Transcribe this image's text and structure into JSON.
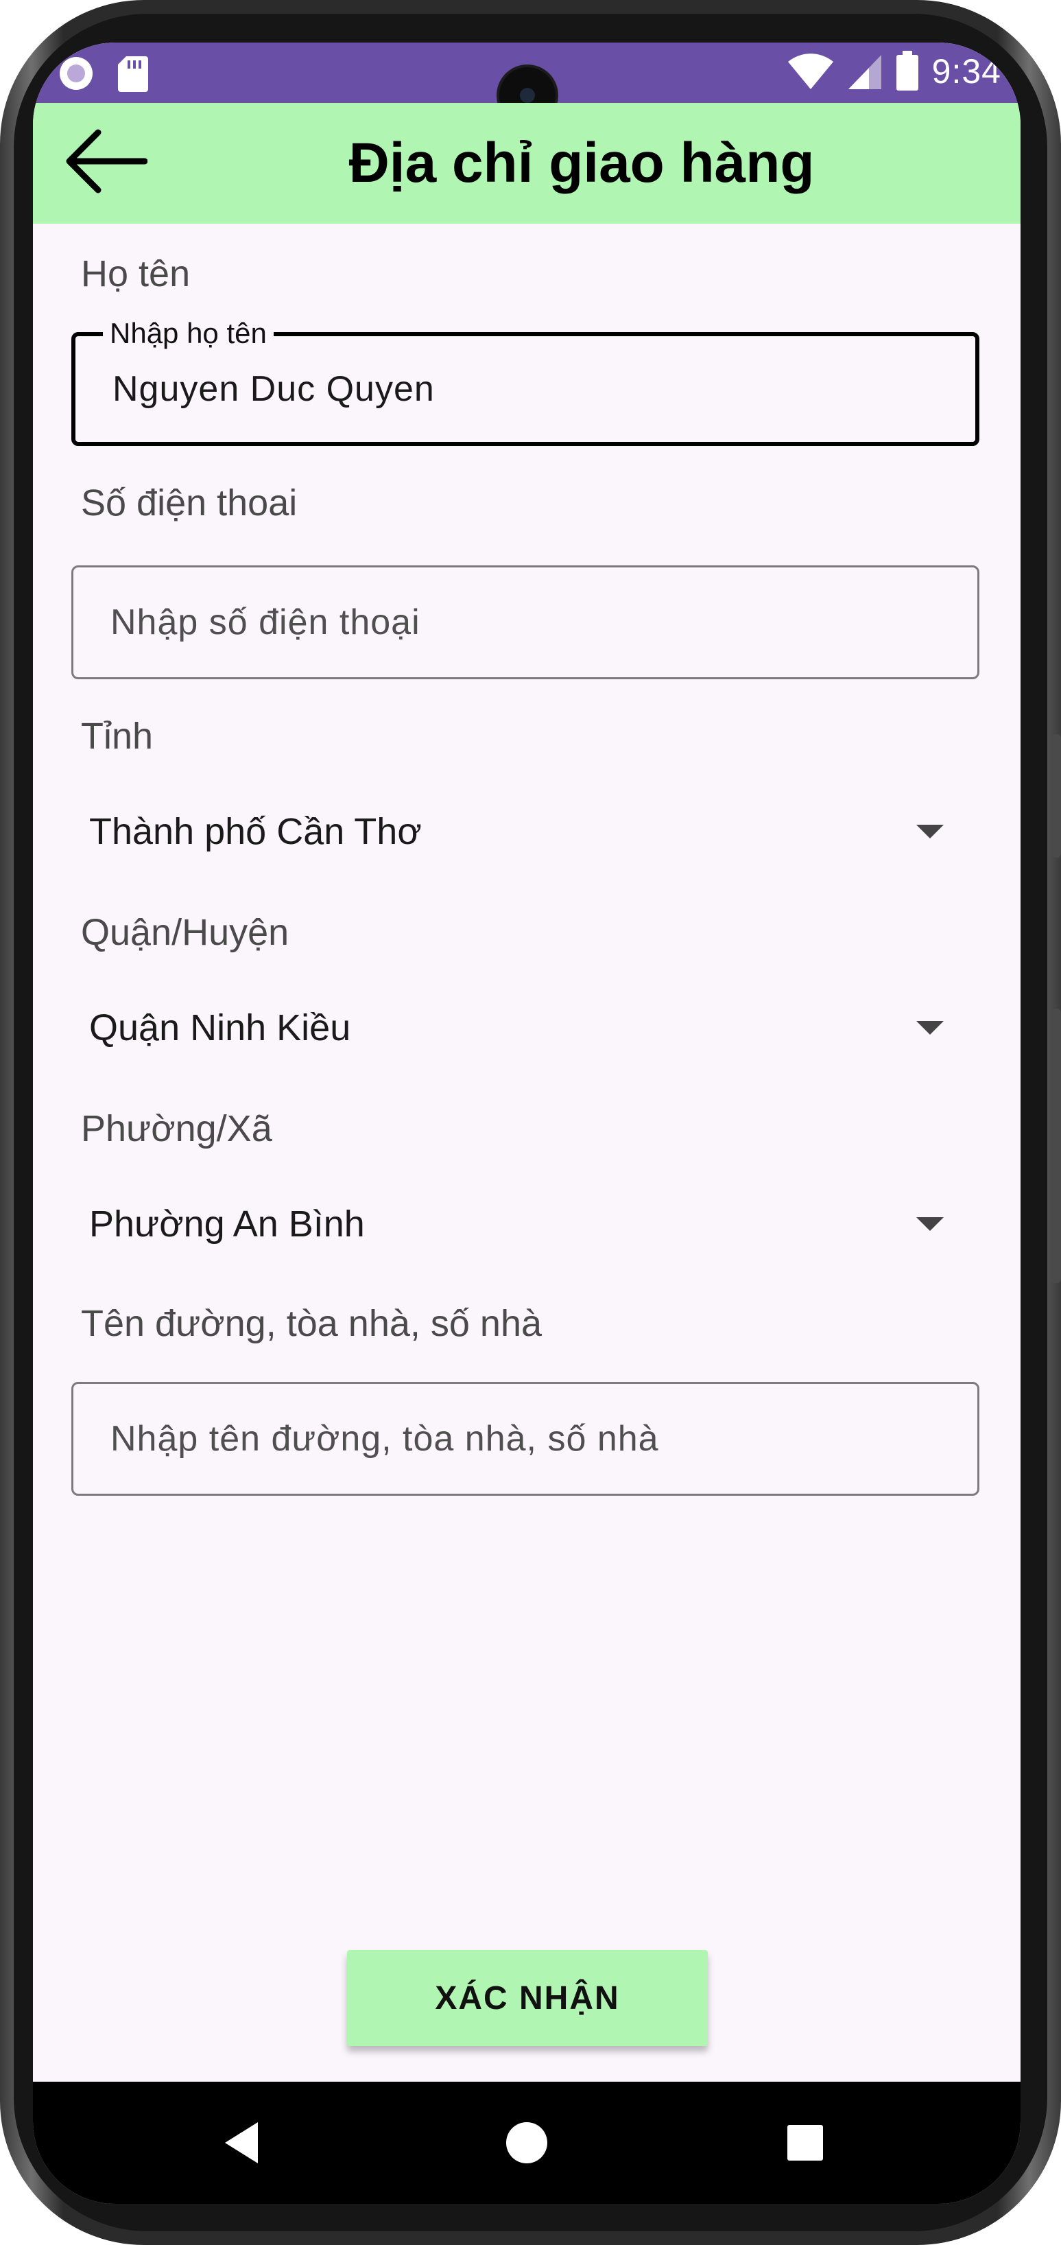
{
  "status_bar": {
    "time": "9:34",
    "left_icons": [
      "record-icon",
      "sd-card-icon"
    ],
    "right_icons": [
      "wifi-icon",
      "signal-icon",
      "battery-icon"
    ],
    "color": "#6950a6"
  },
  "app_bar": {
    "title": "Địa chỉ giao hàng",
    "back_icon": "arrow-back-icon",
    "color": "#b0f5b2"
  },
  "form": {
    "name": {
      "label": "Họ tên",
      "floating_label": "Nhập họ tên",
      "value": "Nguyen Duc Quyen"
    },
    "phone": {
      "label": "Số điện thoai",
      "placeholder": "Nhập số điện thoại",
      "value": ""
    },
    "province": {
      "label": "Tỉnh",
      "selected": "Thành phố Cần Thơ"
    },
    "district": {
      "label": "Quận/Huyện",
      "selected": "Quận Ninh Kiều"
    },
    "ward": {
      "label": "Phường/Xã",
      "selected": "Phường An Bình"
    },
    "street": {
      "label": "Tên đường, tòa nhà, số nhà",
      "placeholder": "Nhập tên đường, tòa nhà, số nhà",
      "value": ""
    }
  },
  "confirm_button": {
    "label": "XÁC NHẬN",
    "color": "#b0f5b2"
  },
  "nav_bar": {
    "icons": [
      "nav-back-icon",
      "nav-home-icon",
      "nav-recents-icon"
    ]
  }
}
